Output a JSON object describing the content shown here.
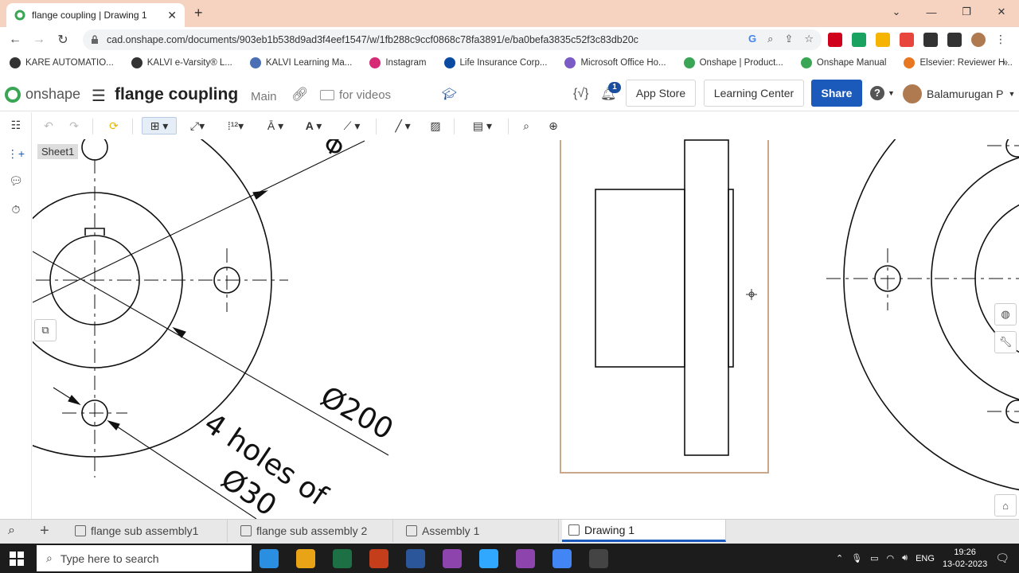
{
  "browser": {
    "tab_title": "flange coupling | Drawing 1",
    "url": "cad.onshape.com/documents/903eb1b538d9ad3f4eef1547/w/1fb288c9ccf0868c78fa3891/e/ba0befa3835c52f3c83db20c",
    "bookmarks": [
      "KARE AUTOMATIO...",
      "KALVI e-Varsity® L...",
      "KALVI Learning Ma...",
      "Instagram",
      "Life Insurance Corp...",
      "Microsoft Office Ho...",
      "Onshape | Product...",
      "Onshape Manual",
      "Elsevier: Reviewer H..."
    ],
    "bookmark_colors": [
      "#333333",
      "#333333",
      "#4a6fb5",
      "#d62976",
      "#0a4aa0",
      "#7b5cc4",
      "#3aa655",
      "#3aa655",
      "#e87722"
    ],
    "extension_colors": [
      "#d0021b",
      "#1aa260",
      "#f4b400",
      "#e8453c",
      "#333333",
      "#333333"
    ]
  },
  "onshape": {
    "logo_text": "onshape",
    "doc_title": "flange coupling",
    "branch": "Main",
    "folder": "for videos",
    "notification_count": "1",
    "app_store": "App Store",
    "learning_center": "Learning Center",
    "share": "Share",
    "help": "?",
    "user_name": "Balamurugan P",
    "accent_color": "#1b5aba",
    "brand_color": "#3aa655"
  },
  "drawing": {
    "sheet": "Sheet1",
    "dim_diameter": "Ø200",
    "holes_note_line1": "4 holes of",
    "holes_note_line2": "Ø30"
  },
  "bottom_tabs": [
    {
      "label": "flange sub assembly1",
      "active": false
    },
    {
      "label": "flange sub assembly 2",
      "active": false
    },
    {
      "label": "Assembly 1",
      "active": false
    },
    {
      "label": "Drawing 1",
      "active": true
    }
  ],
  "taskbar": {
    "search_placeholder": "Type here to search",
    "language": "ENG",
    "time": "19:26",
    "date": "13-02-2023",
    "app_colors": [
      "#2a8fe0",
      "#e8a317",
      "#1d7044",
      "#c43e1c",
      "#2b579a",
      "#8e44ad",
      "#31a8ff",
      "#8e44ad",
      "#4285f4",
      "#444444"
    ]
  }
}
